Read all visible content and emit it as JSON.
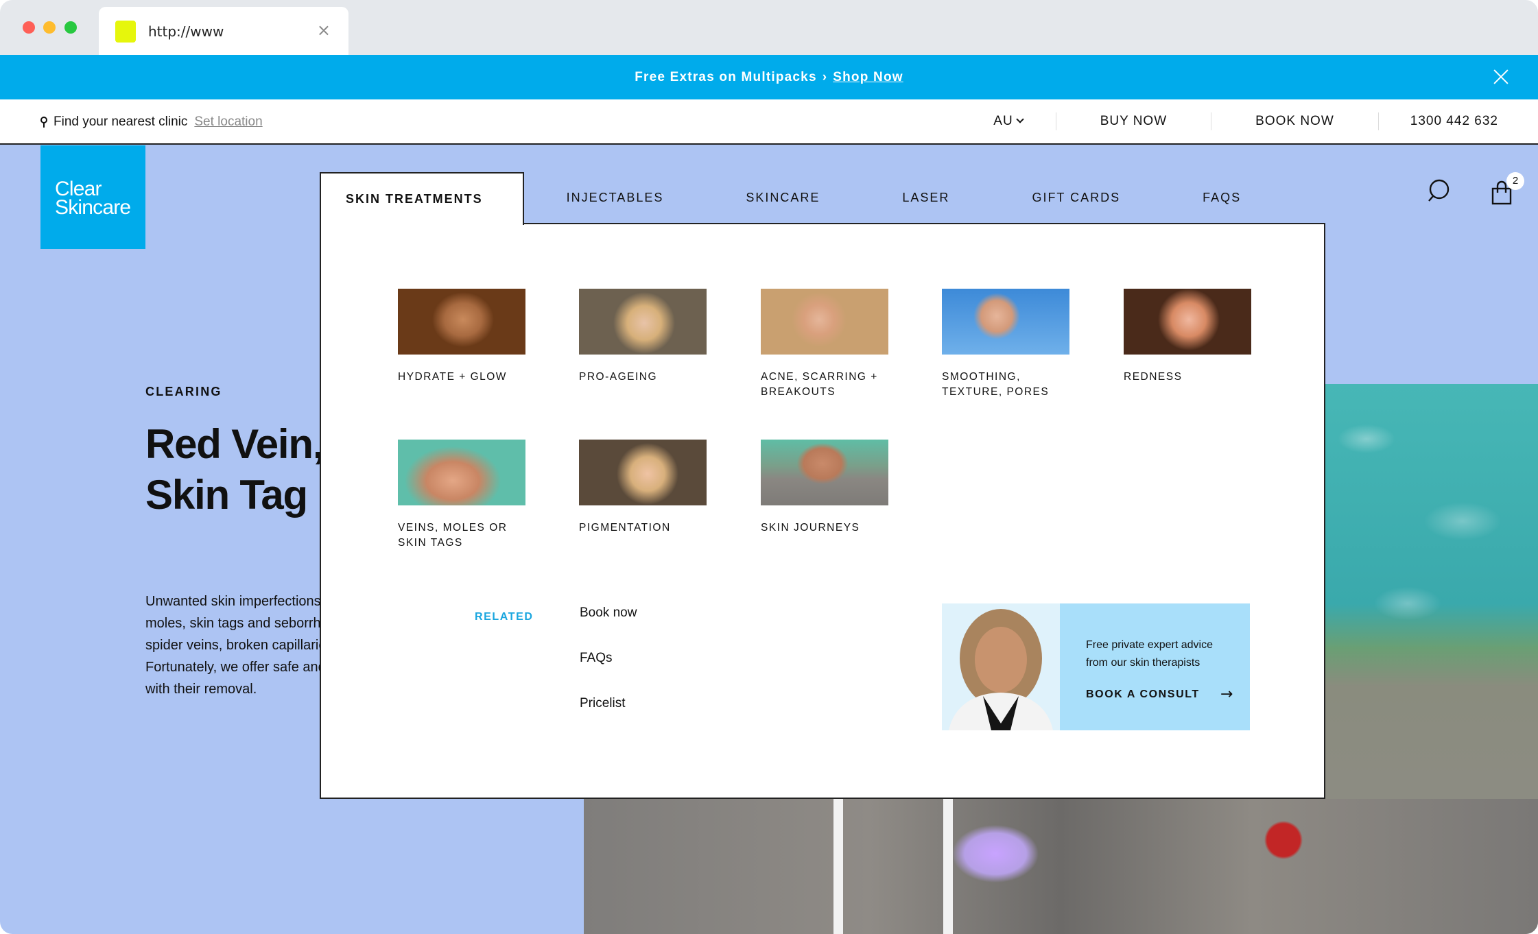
{
  "browser": {
    "tab_title": "http://www",
    "tab_close": "×"
  },
  "announcement": {
    "text": "Free Extras on Multipacks",
    "separator": "›",
    "link": "Shop Now"
  },
  "utility": {
    "find_clinic": "Find your nearest clinic",
    "set_location": "Set location",
    "region": "AU",
    "buy_now": "BUY NOW",
    "book_now": "BOOK NOW",
    "phone": "1300 442 632"
  },
  "logo": {
    "line1": "Clear",
    "line2": "Skincare"
  },
  "nav": {
    "items": [
      {
        "label": "SKIN TREATMENTS",
        "active": true
      },
      {
        "label": "INJECTABLES"
      },
      {
        "label": "SKINCARE"
      },
      {
        "label": "LASER"
      },
      {
        "label": "GIFT CARDS"
      },
      {
        "label": "FAQS"
      }
    ],
    "cart_count": "2"
  },
  "hero": {
    "eyebrow": "CLEARING",
    "title": "Red Vein, Mole & Skin Tag Removal",
    "body": "Unwanted skin imperfections such as raised lesions such as moles, skin tags and seborrheic keratosis, as well as red vein, spider veins, broken capillaries and cherry angiomas. Fortunately, we offer safe and simple procedures that can help with their removal."
  },
  "mega_menu": {
    "cards": [
      {
        "label": "HYDRATE + GLOW"
      },
      {
        "label": "PRO-AGEING"
      },
      {
        "label": "ACNE, SCARRING + BREAKOUTS"
      },
      {
        "label": "SMOOTHING, TEXTURE, PORES"
      },
      {
        "label": "REDNESS"
      },
      {
        "label": "VEINS, MOLES OR SKIN TAGS"
      },
      {
        "label": "PIGMENTATION"
      },
      {
        "label": "SKIN JOURNEYS"
      }
    ],
    "related_heading": "RELATED",
    "related_links": [
      "Book now",
      "FAQs",
      "Pricelist"
    ],
    "consult": {
      "text": "Free private expert advice from our skin therapists",
      "cta": "BOOK A CONSULT",
      "arrow": "→"
    }
  },
  "colors": {
    "brand_blue": "#00abeb",
    "hero_bg": "#adc4f3",
    "consult_bg": "#a9dffa",
    "related_accent": "#1aa6df"
  }
}
